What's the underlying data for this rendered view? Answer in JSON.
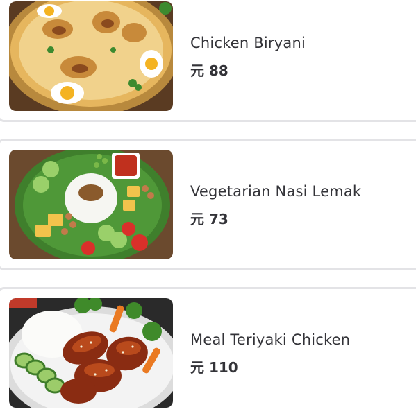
{
  "menu": {
    "items": [
      {
        "name": "Chicken Biryani",
        "price": "元 88"
      },
      {
        "name": "Vegetarian Nasi Lemak",
        "price": "元 73"
      },
      {
        "name": "Meal Teriyaki Chicken",
        "price": "元 110"
      }
    ]
  }
}
